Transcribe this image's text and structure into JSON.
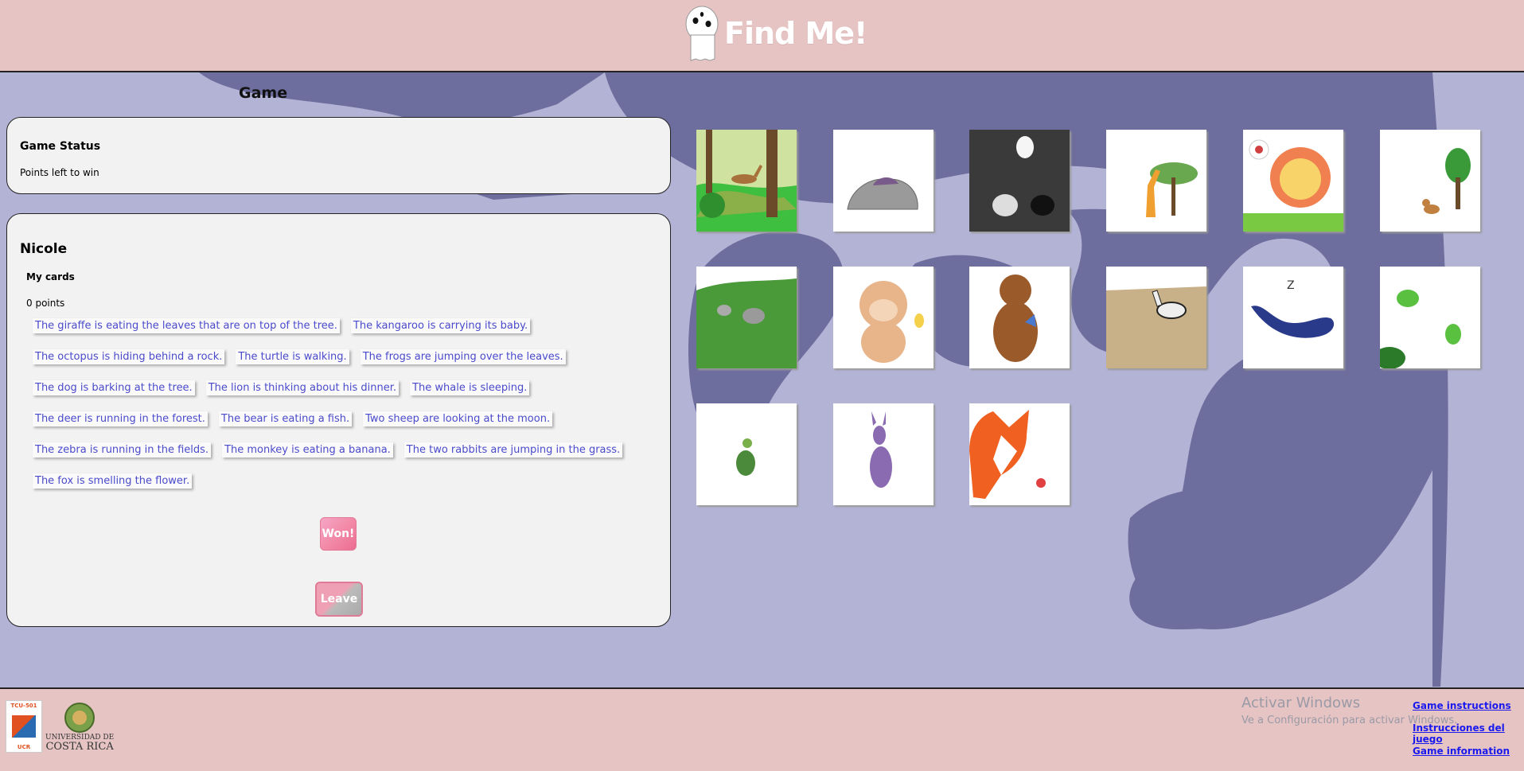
{
  "header": {
    "title": "Find Me!"
  },
  "main": {
    "section_title": "Game"
  },
  "status": {
    "title": "Game Status",
    "points_label": "Points left to win"
  },
  "player": {
    "name": "Nicole",
    "cards_label": "My cards",
    "points": "0 points",
    "card_rows": [
      [
        "The giraffe is eating the leaves that are on top of the tree.",
        "The kangaroo is carrying its baby."
      ],
      [
        "The octopus is hiding behind a rock.",
        "The turtle is walking.",
        "The frogs are jumping over the leaves."
      ],
      [
        "The dog is barking at the tree.",
        "The lion is thinking about his dinner.",
        "The whale is sleeping."
      ],
      [
        "The deer is running in the forest.",
        "The bear is eating a fish.",
        "Two sheep are looking at the moon."
      ],
      [
        "The zebra is running in the fields.",
        "The monkey is eating a banana.",
        "The two rabbits are jumping in the grass."
      ],
      [
        "The fox is smelling the flower."
      ]
    ],
    "won_label": "Won!",
    "leave_label": "Leave"
  },
  "board": {
    "tiles": [
      "deer",
      "octopus",
      "sheep",
      "giraffe",
      "lion",
      "dog",
      "rabbits",
      "monkey",
      "bear",
      "zebra",
      "whale",
      "frogs",
      "turtle",
      "kangaroo",
      "fox"
    ]
  },
  "footer": {
    "logo_tcu": "TCU-501",
    "logo_ucr": "UCR",
    "university_line1": "UNIVERSIDAD DE",
    "university_line2": "COSTA RICA",
    "watermark_title": "Activar Windows",
    "watermark_sub": "Ve a Configuración para activar Windows.",
    "links": [
      "Game instructions",
      "Instrucciones del juego",
      "Game information"
    ]
  },
  "colors": {
    "header_bg": "#e6c4c4",
    "background": "#b3b3d6",
    "blob": "#6e6e9e",
    "link": "#4a4acc"
  }
}
